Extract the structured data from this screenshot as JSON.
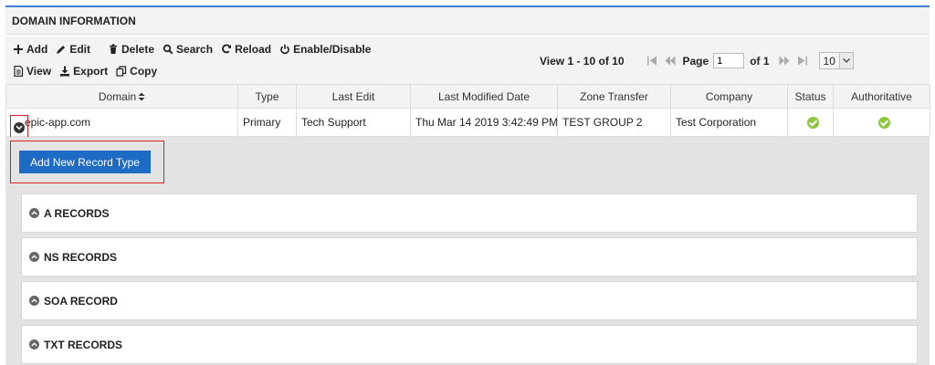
{
  "panel": {
    "title": "DOMAIN INFORMATION",
    "accent": "#3f7fcf"
  },
  "toolbar": {
    "add": "Add",
    "edit": "Edit",
    "delete": "Delete",
    "search": "Search",
    "reload": "Reload",
    "enable_disable": "Enable/Disable",
    "view": "View",
    "export": "Export",
    "copy": "Copy"
  },
  "pager": {
    "view_text": "View 1 - 10 of 10",
    "page_label": "Page",
    "page_value": "1",
    "of_text": "of 1",
    "page_size": "10"
  },
  "table": {
    "columns": [
      "Domain",
      "Type",
      "Last Edit",
      "Last Modified Date",
      "Zone Transfer",
      "Company",
      "Status",
      "Authoritative"
    ],
    "rows": [
      {
        "domain": "epic-app.com",
        "type": "Primary",
        "last_edit": "Tech Support",
        "last_modified": "Thu Mar 14 2019 3:42:49 PM",
        "zone_transfer": "TEST GROUP 2",
        "company": "Test Corporation",
        "status": "check-icon",
        "authoritative": "check-icon"
      }
    ]
  },
  "detail": {
    "add_button": "Add New Record Type",
    "records": [
      "A RECORDS",
      "NS RECORDS",
      "SOA RECORD",
      "TXT RECORDS"
    ]
  },
  "colors": {
    "primary_button": "#1e6bc5",
    "status_ok": "#8dc63f",
    "highlight": "#e02020"
  }
}
